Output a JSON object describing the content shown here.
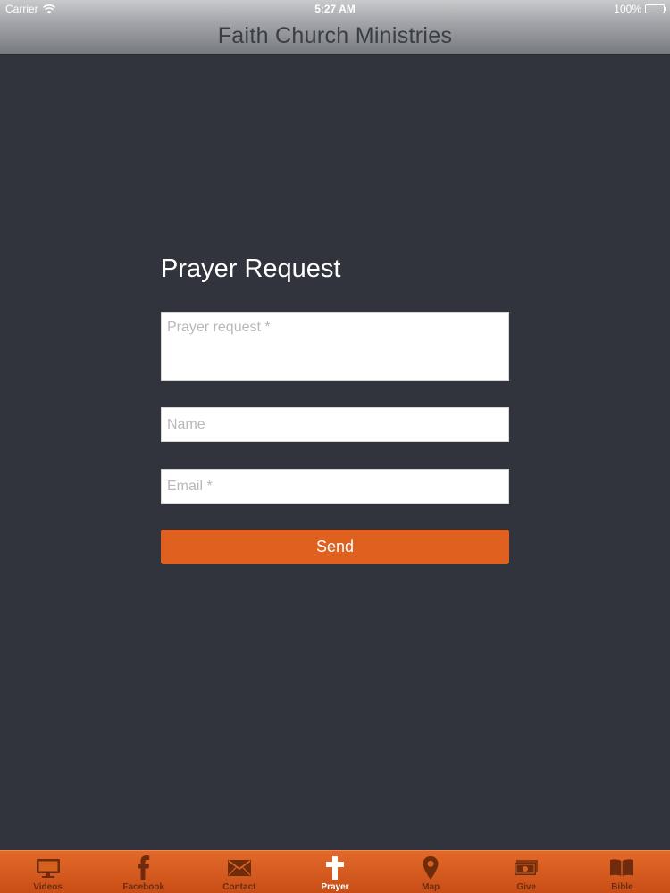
{
  "status_bar": {
    "carrier": "Carrier",
    "time": "5:27 AM",
    "battery": "100%"
  },
  "header": {
    "title": "Faith Church Ministries"
  },
  "form": {
    "title": "Prayer Request",
    "prayer_placeholder": "Prayer request *",
    "name_placeholder": "Name",
    "email_placeholder": "Email *",
    "send_label": "Send"
  },
  "tabs": [
    {
      "label": "Videos",
      "icon": "monitor-icon",
      "active": false
    },
    {
      "label": "Facebook",
      "icon": "facebook-icon",
      "active": false
    },
    {
      "label": "Contact",
      "icon": "envelope-icon",
      "active": false
    },
    {
      "label": "Prayer",
      "icon": "cross-icon",
      "active": true
    },
    {
      "label": "Map",
      "icon": "map-pin-icon",
      "active": false
    },
    {
      "label": "Give",
      "icon": "money-icon",
      "active": false
    },
    {
      "label": "Bible",
      "icon": "book-icon",
      "active": false
    }
  ],
  "colors": {
    "background": "#31343c",
    "accent": "#e0601f",
    "tab_inactive": "#6e2c0c",
    "tab_active": "#ffffff"
  }
}
